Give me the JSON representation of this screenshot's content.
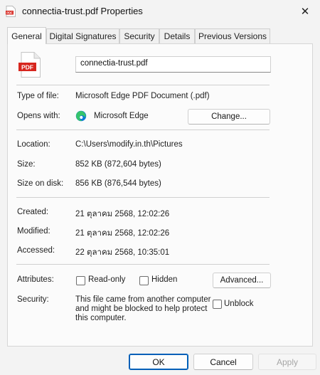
{
  "window": {
    "title": "connectia-trust.pdf Properties",
    "close_glyph": "✕"
  },
  "tabs": [
    {
      "label": "General"
    },
    {
      "label": "Digital Signatures"
    },
    {
      "label": "Security"
    },
    {
      "label": "Details"
    },
    {
      "label": "Previous Versions"
    }
  ],
  "general": {
    "file_icon_text": "PDF",
    "file_name": "connectia-trust.pdf",
    "type_label": "Type of file:",
    "type_value": "Microsoft Edge PDF Document (.pdf)",
    "opens_label": "Opens with:",
    "opens_value": "Microsoft Edge",
    "change_button": "Change...",
    "location_label": "Location:",
    "location_value": "C:\\Users\\modify.in.th\\Pictures",
    "size_label": "Size:",
    "size_value": "852 KB (872,604 bytes)",
    "size_on_disk_label": "Size on disk:",
    "size_on_disk_value": "856 KB (876,544 bytes)",
    "created_label": "Created:",
    "created_value": "21 ตุลาคม 2568, 12:02:26",
    "modified_label": "Modified:",
    "modified_value": "21 ตุลาคม 2568, 12:02:26",
    "accessed_label": "Accessed:",
    "accessed_value": "22 ตุลาคม 2568, 10:35:01",
    "attributes_label": "Attributes:",
    "readonly_label": "Read-only",
    "readonly_checked": false,
    "hidden_label": "Hidden",
    "hidden_checked": false,
    "advanced_button": "Advanced...",
    "security_label": "Security:",
    "security_line1": "This file came from another computer",
    "security_line2": "and might be blocked to help protect",
    "security_line3": "this computer.",
    "unblock_label": "Unblock",
    "unblock_checked": false
  },
  "footer": {
    "ok": "OK",
    "cancel": "Cancel",
    "apply": "Apply"
  },
  "colors": {
    "accent": "#005fb8",
    "pdf_red": "#d7261e",
    "edge_blue": "#0c7ad8",
    "edge_green": "#36c46b"
  }
}
